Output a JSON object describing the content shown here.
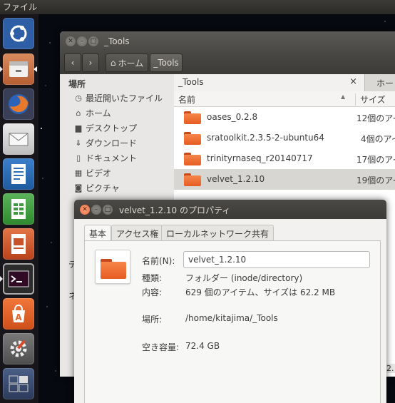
{
  "top_panel": {
    "app_menu": "ファイル"
  },
  "launcher": {
    "items": [
      {
        "icon": "dash-icon",
        "color": "#3a6fb8"
      },
      {
        "icon": "files-icon",
        "color": "#c97a4e"
      },
      {
        "icon": "firefox-icon",
        "color": "#e8792a"
      },
      {
        "icon": "mail-icon",
        "color": "#d8d8d8"
      },
      {
        "icon": "writer-icon",
        "color": "#2f6fb6"
      },
      {
        "icon": "calc-icon",
        "color": "#3f9a3f"
      },
      {
        "icon": "impress-icon",
        "color": "#c8532a"
      },
      {
        "icon": "terminal-icon",
        "color": "#2c2c2c"
      },
      {
        "icon": "software-center-icon",
        "color": "#e8652a"
      },
      {
        "icon": "system-settings-icon",
        "color": "#8a8a8a"
      },
      {
        "icon": "workspace-switcher-icon",
        "color": "#3a4e72"
      }
    ]
  },
  "file_manager": {
    "title": "_Tools",
    "breadcrumb": {
      "home": "ホーム",
      "current": "_Tools"
    },
    "sidebar": {
      "heading": "場所",
      "items": [
        {
          "label": "最近開いたファイル",
          "glyph": "◷"
        },
        {
          "label": "ホーム",
          "glyph": "⌂"
        },
        {
          "label": "デスクトップ",
          "glyph": "▆"
        },
        {
          "label": "ダウンロード",
          "glyph": "⇓"
        },
        {
          "label": "ドキュメント",
          "glyph": "▯"
        },
        {
          "label": "ビデオ",
          "glyph": "▦"
        },
        {
          "label": "ピクチャ",
          "glyph": "◙"
        }
      ],
      "partial_labels": [
        "デ",
        "ネ"
      ]
    },
    "tabs": [
      {
        "label": "_Tools",
        "close": "×"
      },
      {
        "label": "ホー"
      }
    ],
    "columns": {
      "name": "名前",
      "size": "サイズ"
    },
    "files": [
      {
        "name": "oases_0.2.8",
        "size": "12個のアイ"
      },
      {
        "name": "sratoolkit.2.3.5-2-ubuntu64",
        "size": "4個のアイ"
      },
      {
        "name": "trinityrnaseq_r20140717",
        "size": "17個のアイ"
      },
      {
        "name": "velvet_1.2.10",
        "size": "19個のアイ",
        "selected": true
      }
    ],
    "status_fragment": "2."
  },
  "properties_dialog": {
    "title": "velvet_1.2.10 のプロパティ",
    "tabs": [
      "基本",
      "アクセス権",
      "ローカルネットワーク共有"
    ],
    "fields": {
      "name_label": "名前(N):",
      "name_value": "velvet_1.2.10",
      "type_label": "種類:",
      "type_value": "フォルダー (inode/directory)",
      "contents_label": "内容:",
      "contents_value": "629 個のアイテム、サイズは 62.2 MB",
      "location_label": "場所:",
      "location_value": "/home/kitajima/_Tools",
      "free_label": "空き容量:",
      "free_value": "72.4 GB"
    }
  }
}
